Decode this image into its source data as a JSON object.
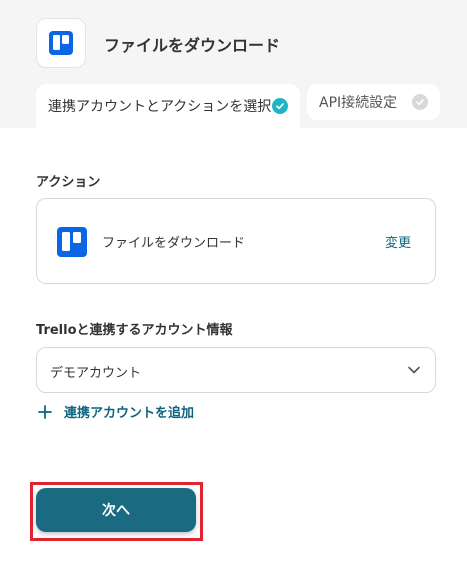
{
  "header": {
    "title": "ファイルをダウンロード",
    "icon": "trello-icon"
  },
  "tabs": [
    {
      "label": "連携アカウントとアクションを選択",
      "completed": true,
      "active": true
    },
    {
      "label": "API接続設定",
      "completed": false,
      "active": false
    }
  ],
  "action_section": {
    "label": "アクション",
    "action_name": "ファイルをダウンロード",
    "change_label": "変更"
  },
  "account_section": {
    "label": "Trelloと連携するアカウント情報",
    "selected_account": "デモアカウント",
    "add_account_label": "連携アカウントを追加"
  },
  "footer": {
    "next_label": "次へ"
  },
  "colors": {
    "accent": "#1a6a82",
    "link": "#0e6480",
    "check_active": "#21b5c4",
    "check_inactive": "#d9d9d9",
    "highlight_border": "#e0232f",
    "trello_blue": "#0c66e4"
  }
}
